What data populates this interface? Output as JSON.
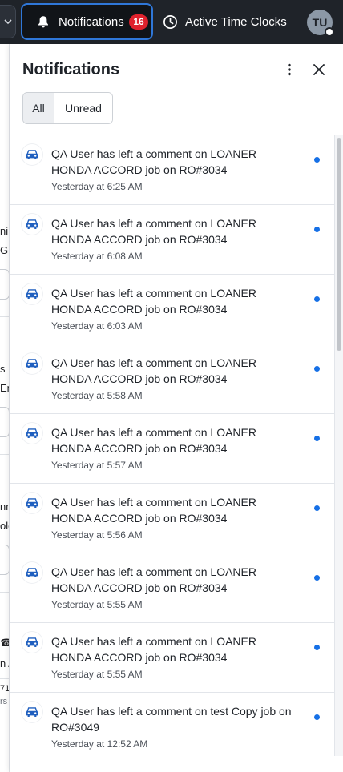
{
  "topbar": {
    "notifications_label": "Notifications",
    "notifications_count": "16",
    "active_time_clocks_label": "Active Time Clocks",
    "avatar_initials": "TU",
    "icons": {
      "notifications": "bell-icon",
      "time_clocks": "clock-icon",
      "left": "chevron-down-icon"
    }
  },
  "background": {
    "fragments": [
      "nim",
      "Gr",
      "s",
      "Em",
      "nm",
      "ole",
      "☎",
      "n A",
      "71",
      "rs"
    ]
  },
  "panel": {
    "title": "Notifications",
    "filters": {
      "all": "All",
      "unread": "Unread",
      "selected": "All"
    },
    "items": [
      {
        "message": "QA User has left a comment on LOANER HONDA ACCORD job on RO#3034",
        "time": "Yesterday at 6:25 AM",
        "unread": true
      },
      {
        "message": "QA User has left a comment on LOANER HONDA ACCORD job on RO#3034",
        "time": "Yesterday at 6:08 AM",
        "unread": true
      },
      {
        "message": "QA User has left a comment on LOANER HONDA ACCORD job on RO#3034",
        "time": "Yesterday at 6:03 AM",
        "unread": true
      },
      {
        "message": "QA User has left a comment on LOANER HONDA ACCORD job on RO#3034",
        "time": "Yesterday at 5:58 AM",
        "unread": true
      },
      {
        "message": "QA User has left a comment on LOANER HONDA ACCORD job on RO#3034",
        "time": "Yesterday at 5:57 AM",
        "unread": true
      },
      {
        "message": "QA User has left a comment on LOANER HONDA ACCORD job on RO#3034",
        "time": "Yesterday at 5:56 AM",
        "unread": true
      },
      {
        "message": "QA User has left a comment on LOANER HONDA ACCORD job on RO#3034",
        "time": "Yesterday at 5:55 AM",
        "unread": true
      },
      {
        "message": "QA User has left a comment on LOANER HONDA ACCORD job on RO#3034",
        "time": "Yesterday at 5:55 AM",
        "unread": true
      },
      {
        "message": "QA User has left a comment on test Copy job on RO#3049",
        "time": "Yesterday at 12:52 AM",
        "unread": true
      }
    ],
    "item_icon": "car-icon",
    "colors": {
      "accent": "#2f77d8",
      "badge": "#e0222d",
      "unread_dot": "#1670e6",
      "icon": "#1f5fbf"
    }
  }
}
